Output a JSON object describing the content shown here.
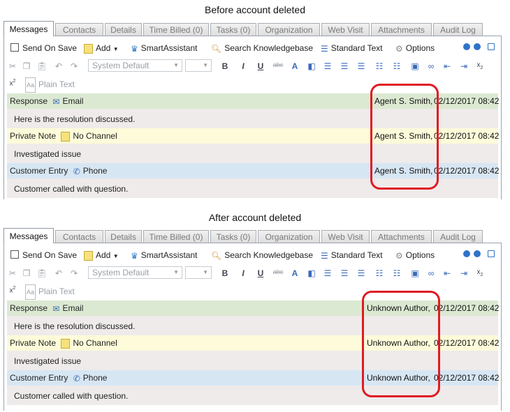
{
  "captions": {
    "before": "Before account deleted",
    "after": "After account deleted"
  },
  "tabs": [
    "Messages",
    "Contacts",
    "Details",
    "Time Billed (0)",
    "Tasks (0)",
    "Organization",
    "Web Visit",
    "Attachments",
    "Audit Log"
  ],
  "toolbar": {
    "send_on_save": "Send On Save",
    "add": "Add",
    "smart_assistant": "SmartAssistant",
    "search_kb": "Search Knowledgebase",
    "standard_text": "Standard Text",
    "options": "Options",
    "font_select": "System Default",
    "plain_text": "Plain Text",
    "bold": "B",
    "italic": "I",
    "underline": "U",
    "strike": "abc",
    "superscript": "x",
    "subscript": "x"
  },
  "before": {
    "rows": [
      {
        "type": "Response",
        "channel": "Email",
        "author": "Agent S. Smith,",
        "date": "02/12/2017 08:42",
        "text": "Here is the resolution discussed."
      },
      {
        "type": "Private Note",
        "channel": "No Channel",
        "author": "Agent S. Smith,",
        "date": "02/12/2017 08:42",
        "text": "Investigated issue"
      },
      {
        "type": "Customer Entry",
        "channel": "Phone",
        "author": "Agent S. Smith,",
        "date": "02/12/2017 08:42",
        "text": "Customer called with question."
      }
    ]
  },
  "after": {
    "rows": [
      {
        "type": "Response",
        "channel": "Email",
        "author": "Unknown Author,",
        "date": "02/12/2017 08:42",
        "text": "Here is the resolution discussed."
      },
      {
        "type": "Private Note",
        "channel": "No Channel",
        "author": "Unknown Author,",
        "date": "02/12/2017 08:42",
        "text": "Investigated issue"
      },
      {
        "type": "Customer Entry",
        "channel": "Phone",
        "author": "Unknown Author,",
        "date": "02/12/2017 08:42",
        "text": "Customer called with question."
      }
    ]
  },
  "colors": {
    "highlight": "#e01b24",
    "response_row": "#dce9d2",
    "note_row": "#fdfbd9",
    "customer_row": "#d7e6f3"
  }
}
